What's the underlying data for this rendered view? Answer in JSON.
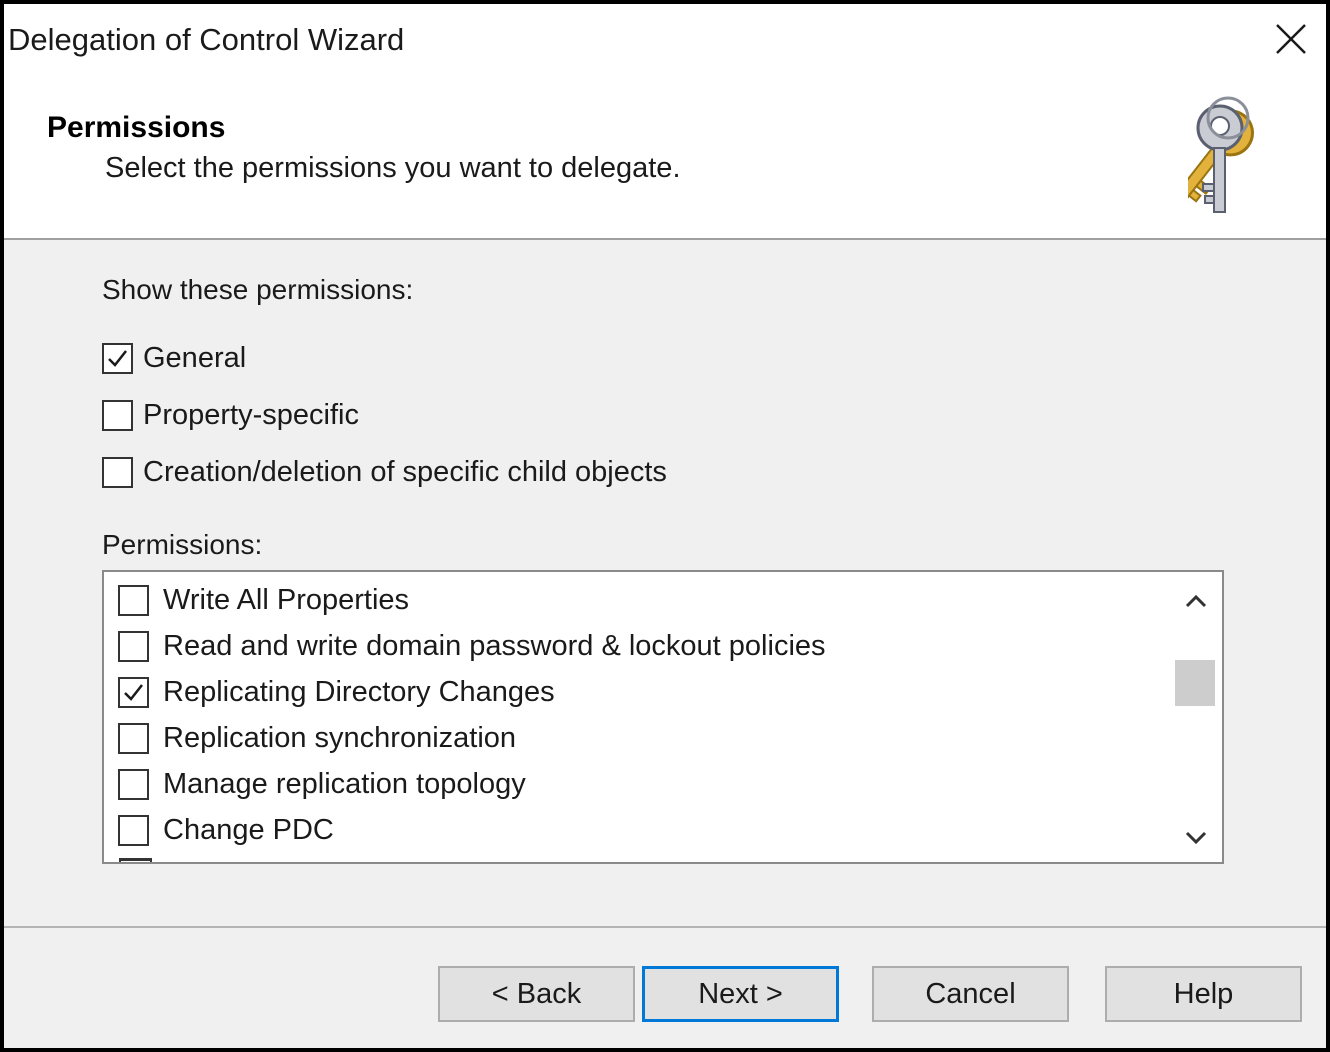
{
  "window": {
    "title": "Delegation of Control Wizard"
  },
  "header": {
    "title": "Permissions",
    "subtitle": "Select the permissions you want to delegate.",
    "icon": "keys-icon"
  },
  "show_permissions": {
    "label": "Show these permissions:",
    "options": [
      {
        "label": "General",
        "checked": true
      },
      {
        "label": "Property-specific",
        "checked": false
      },
      {
        "label": "Creation/deletion of specific child objects",
        "checked": false
      }
    ]
  },
  "permissions": {
    "label": "Permissions:",
    "items": [
      {
        "label": "Write All Properties",
        "checked": false
      },
      {
        "label": "Read and write domain password & lockout policies",
        "checked": false
      },
      {
        "label": "Replicating Directory Changes",
        "checked": true
      },
      {
        "label": "Replication synchronization",
        "checked": false
      },
      {
        "label": "Manage replication topology",
        "checked": false
      },
      {
        "label": "Change PDC",
        "checked": false
      }
    ]
  },
  "buttons": {
    "back": "< Back",
    "next": "Next >",
    "cancel": "Cancel",
    "help": "Help"
  },
  "colors": {
    "default_button_border": "#0078d7",
    "dialog_background": "#f0f0f0"
  }
}
